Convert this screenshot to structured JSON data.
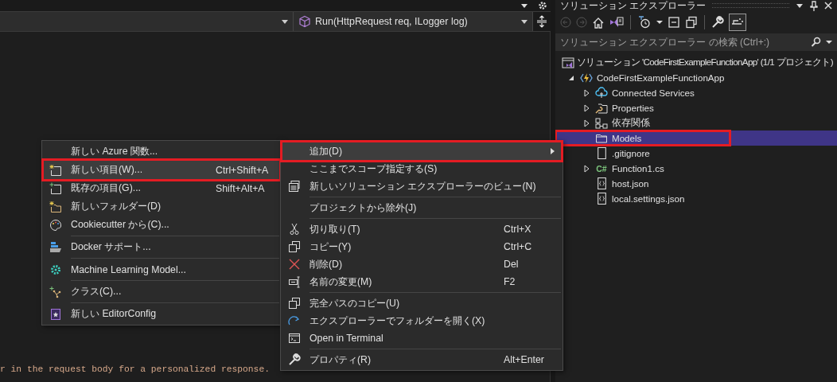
{
  "editor": {
    "member_dropdown": "Run(HttpRequest req, ILogger log)",
    "code_line": "r in the request body for a personalized response."
  },
  "solution_explorer": {
    "title": "ソリューション エクスプローラー",
    "search": {
      "placeholder": "ソリューション エクスプローラー の検索 (Ctrl+:)"
    },
    "tree": [
      {
        "label": "ソリューション 'CodeFirstExampleFunctionApp' (1/1 プロジェクト)",
        "kind": "solution",
        "selected": false,
        "annotated": false,
        "children": [
          {
            "label": "CodeFirstExampleFunctionApp",
            "kind": "function",
            "expanded": true,
            "selected": false,
            "annotated": false,
            "children": [
              {
                "label": "Connected Services",
                "kind": "cloud",
                "expanded": false,
                "selected": false,
                "annotated": false
              },
              {
                "label": "Properties",
                "kind": "properties",
                "expanded": false,
                "selected": false,
                "annotated": false
              },
              {
                "label": "依存関係",
                "kind": "dependencies",
                "expanded": false,
                "selected": false,
                "annotated": false
              },
              {
                "label": "Models",
                "kind": "folder",
                "selected": true,
                "annotated": true
              },
              {
                "label": ".gitignore",
                "kind": "file",
                "selected": false,
                "annotated": false
              },
              {
                "label": "Function1.cs",
                "kind": "csharp",
                "badge": "C#",
                "expanded": false,
                "selected": false,
                "annotated": false
              },
              {
                "label": "host.json",
                "kind": "json",
                "selected": false,
                "annotated": false
              },
              {
                "label": "local.settings.json",
                "kind": "json",
                "selected": false,
                "annotated": false
              }
            ]
          }
        ]
      }
    ]
  },
  "context_menu": {
    "groups": [
      [
        {
          "label": "追加(D)",
          "kind": "plain",
          "submenu": true,
          "selected": true,
          "annotated": true
        },
        {
          "label": "ここまでスコープ指定する(S)",
          "kind": "plain",
          "submenu": false,
          "selected": false,
          "annotated": false
        },
        {
          "label": "新しいソリューション エクスプローラーのビュー(N)",
          "kind": "view",
          "submenu": false,
          "selected": false,
          "annotated": false
        }
      ],
      [
        {
          "label": "プロジェクトから除外(J)",
          "kind": "plain",
          "submenu": false,
          "selected": false,
          "annotated": false
        }
      ],
      [
        {
          "label": "切り取り(T)",
          "kind": "cut",
          "shortcut": "Ctrl+X",
          "submenu": false,
          "selected": false,
          "annotated": false
        },
        {
          "label": "コピー(Y)",
          "kind": "copy",
          "shortcut": "Ctrl+C",
          "submenu": false,
          "selected": false,
          "annotated": false
        },
        {
          "label": "削除(D)",
          "kind": "delete",
          "shortcut": "Del",
          "submenu": false,
          "selected": false,
          "annotated": false
        },
        {
          "label": "名前の変更(M)",
          "kind": "rename",
          "shortcut": "F2",
          "submenu": false,
          "selected": false,
          "annotated": false
        }
      ],
      [
        {
          "label": "完全パスのコピー(U)",
          "kind": "copy",
          "submenu": false,
          "selected": false,
          "annotated": false
        },
        {
          "label": "エクスプローラーでフォルダーを開く(X)",
          "kind": "open-folder",
          "submenu": false,
          "selected": false,
          "annotated": false
        },
        {
          "label": "Open in Terminal",
          "kind": "terminal",
          "submenu": false,
          "selected": false,
          "annotated": false
        }
      ],
      [
        {
          "label": "プロパティ(R)",
          "kind": "wrench",
          "shortcut": "Alt+Enter",
          "submenu": false,
          "selected": false,
          "annotated": false
        }
      ]
    ]
  },
  "add_submenu": {
    "groups": [
      [
        {
          "label": "新しい Azure 関数...",
          "kind": "plain",
          "submenu": false,
          "selected": false,
          "annotated": false
        },
        {
          "label": "新しい項目(W)...",
          "kind": "new-item",
          "shortcut": "Ctrl+Shift+A",
          "submenu": false,
          "selected": true,
          "annotated": true
        },
        {
          "label": "既存の項目(G)...",
          "kind": "existing-item",
          "shortcut": "Shift+Alt+A",
          "submenu": false,
          "selected": false,
          "annotated": false
        },
        {
          "label": "新しいフォルダー(D)",
          "kind": "new-folder",
          "submenu": false,
          "selected": false,
          "annotated": false
        },
        {
          "label": "Cookiecutter から(C)...",
          "kind": "palette",
          "submenu": false,
          "selected": false,
          "annotated": false
        }
      ],
      [
        {
          "label": "Docker サポート...",
          "kind": "docker",
          "submenu": false,
          "selected": false,
          "annotated": false
        }
      ],
      [
        {
          "label": "Machine Learning Model...",
          "kind": "gear",
          "submenu": false,
          "selected": false,
          "annotated": false
        }
      ],
      [
        {
          "label": "クラス(C)...",
          "kind": "class",
          "submenu": false,
          "selected": false,
          "annotated": false
        }
      ],
      [
        {
          "label": "新しい EditorConfig",
          "kind": "editorconfig",
          "submenu": false,
          "selected": false,
          "annotated": false
        }
      ]
    ]
  }
}
